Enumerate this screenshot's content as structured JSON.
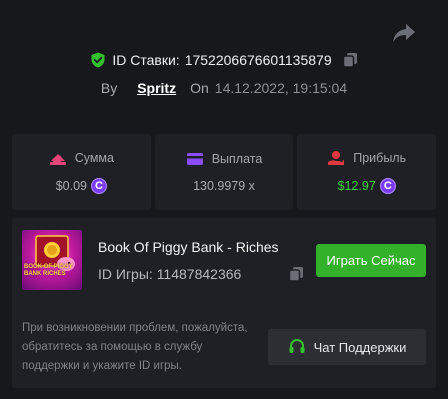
{
  "header": {
    "bet_id_label": "ID Ставки:",
    "bet_id": "1752206676601135879",
    "by_label": "By",
    "username": "Spritz",
    "on_label": "On",
    "datetime": "14.12.2022, 19:15:04"
  },
  "stats": [
    {
      "label": "Сумма",
      "value": "$0.09",
      "icon": "wallet-icon",
      "coin": true
    },
    {
      "label": "Выплата",
      "value": "130.9979 x",
      "icon": "card-icon",
      "coin": false
    },
    {
      "label": "Прибыль",
      "value": "$12.97",
      "icon": "profit-hand-icon",
      "coin": true
    }
  ],
  "currency_symbol": "C",
  "game": {
    "title": "Book Of Piggy Bank - Riches",
    "id_label": "ID Игры:",
    "id": "11487842366",
    "thumb_text": "BOOK OF PIGGY BANK RICHES",
    "play_label": "Играть Сейчас"
  },
  "support": {
    "help_text": "При возникновении проблем, пожалуйста, обратитесь за помощью в службу поддержки и укажите ID игры.",
    "button_label": "Чат Поддержки"
  },
  "colors": {
    "background": "#17181c",
    "card": "#1f2025",
    "accent_green": "#34b12a",
    "profit_green": "#3ed23b",
    "coin_purple": "#7a3cf5",
    "stat_icon_pink": "#e8457a",
    "stat_icon_purple": "#8b4dff",
    "stat_icon_red": "#e0383e"
  }
}
